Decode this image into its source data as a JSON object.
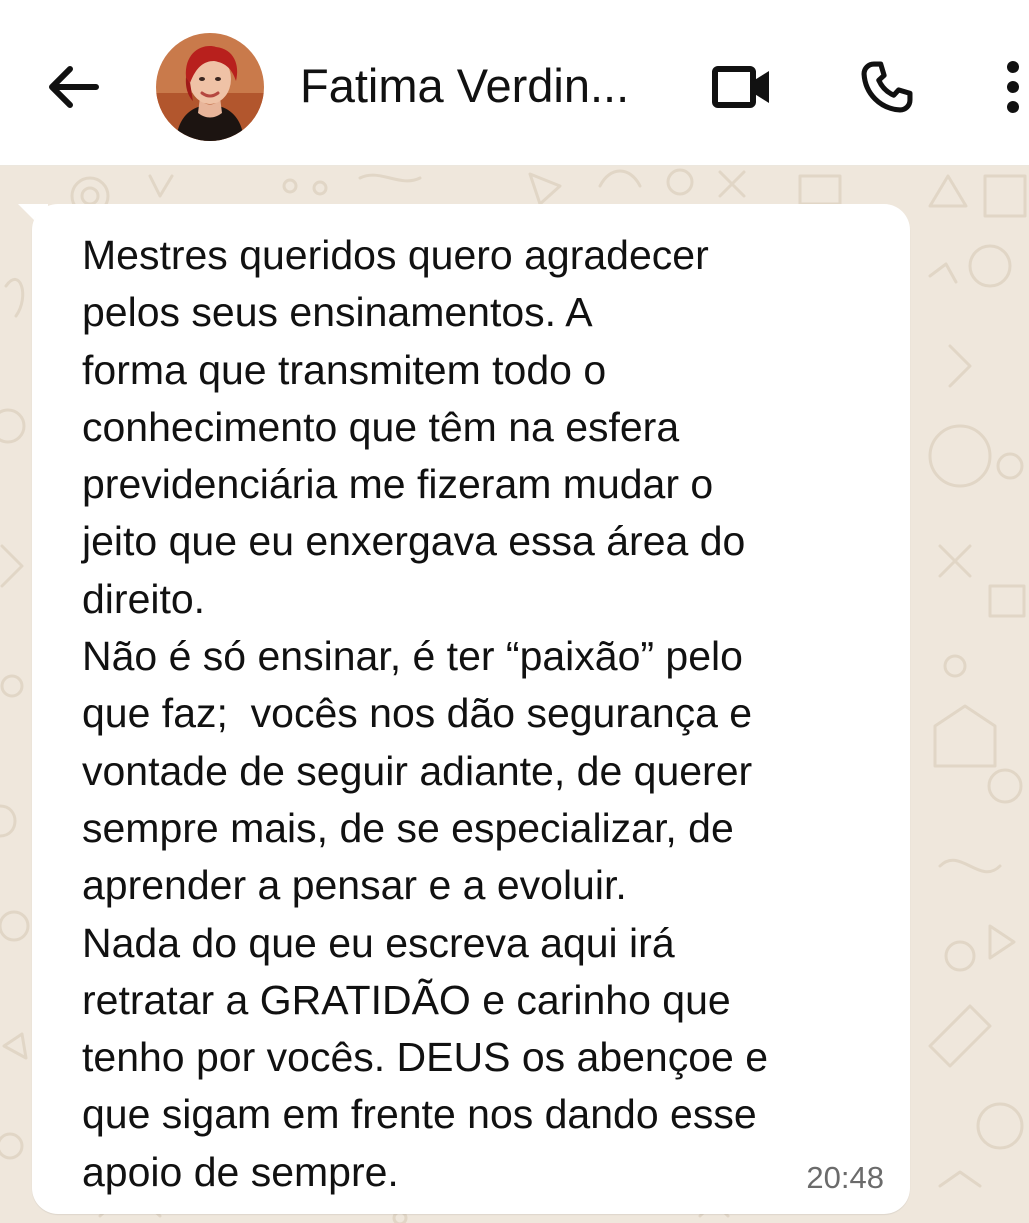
{
  "header": {
    "back_icon": "arrow-left-icon",
    "contact_name": "Fatima Verdin...",
    "avatar_icon": "contact-avatar",
    "video_icon": "video-camera-icon",
    "call_icon": "phone-icon",
    "menu_icon": "more-vertical-icon"
  },
  "message": {
    "text": "Mestres queridos quero agradecer\npelos seus ensinamentos. A\nforma que transmitem todo o\nconhecimento que têm na esfera\nprevidenciária me fizeram mudar o\njeito que eu enxergava essa área do\ndireito.\nNão é só ensinar, é ter “paixão” pelo\nque faz;  vocês nos dão segurança e\nvontade de seguir adiante, de querer\nsempre mais, de se especializar, de\naprender a pensar e a evoluir.\nNada do que eu escreva aqui irá\nretratar a GRATIDÃO e carinho que\ntenho por vocês. DEUS os abençoe e\nque sigam em frente nos dando esse\napoio de sempre.",
    "time": "20:48"
  },
  "colors": {
    "header_bg": "#ffffff",
    "wallpaper": "#efe7dc",
    "bubble": "#ffffff",
    "text": "#111111",
    "timestamp": "#6b6b6b"
  }
}
